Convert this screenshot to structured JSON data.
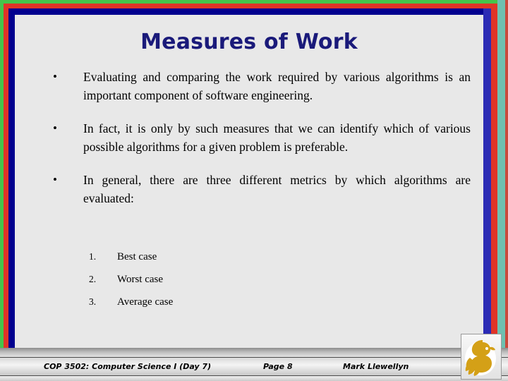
{
  "slide": {
    "title": "Measures of Work",
    "background_color": "#e8e8e8",
    "title_color": "#1a1a7a"
  },
  "frame": {
    "green": "#46c44a",
    "red": "#e03427",
    "navy": "#00008f",
    "blue": "#2b2bb5",
    "teal": "#6ec0b0"
  },
  "bullets": [
    {
      "marker": "•",
      "text": "Evaluating and comparing the work required by various algorithms is an important component of software engineering."
    },
    {
      "marker": "•",
      "text": "In fact, it is only by such measures that we can identify which of various possible algorithms for a given problem is preferable."
    },
    {
      "marker": "•",
      "text": "In general, there are three different metrics by which algorithms are evaluated:"
    }
  ],
  "numbered_list": [
    {
      "marker": "1.",
      "text": "Best case"
    },
    {
      "marker": "2.",
      "text": "Worst case"
    },
    {
      "marker": "3.",
      "text": "Average case"
    }
  ],
  "footer": {
    "course": "COP 3502: Computer Science I  (Day 7)",
    "page": "Page 8",
    "author": "Mark Llewellyn",
    "logo_name": "ucf-pegasus-logo",
    "logo_color": "#d4a017"
  }
}
